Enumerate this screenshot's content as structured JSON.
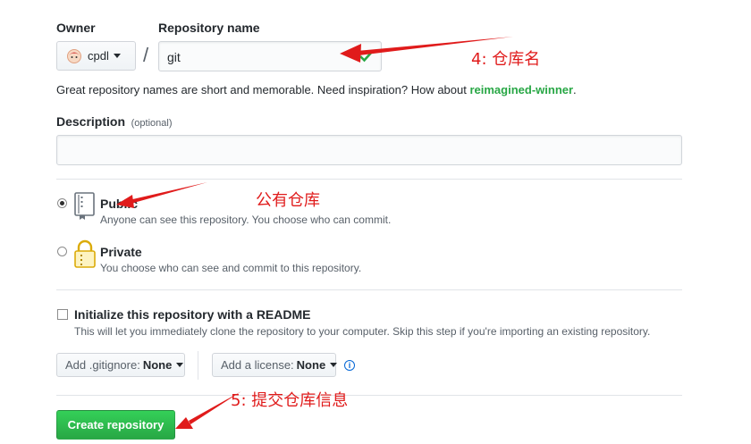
{
  "owner": {
    "label": "Owner",
    "value": "cpdl"
  },
  "repo": {
    "label": "Repository name",
    "value": "git"
  },
  "slash": "/",
  "hint": {
    "prefix": "Great repository names are short and memorable. Need inspiration? How about ",
    "suggestion": "reimagined-winner",
    "suffix": "."
  },
  "description": {
    "label": "Description",
    "optional": "(optional)",
    "value": ""
  },
  "visibility": {
    "public": {
      "title": "Public",
      "desc": "Anyone can see this repository. You choose who can commit.",
      "checked": true
    },
    "private": {
      "title": "Private",
      "desc": "You choose who can see and commit to this repository.",
      "checked": false
    }
  },
  "readme": {
    "label": "Initialize this repository with a README",
    "desc": "This will let you immediately clone the repository to your computer. Skip this step if you're importing an existing repository.",
    "checked": false
  },
  "gitignore": {
    "prefix": "Add .gitignore:",
    "value": "None"
  },
  "license": {
    "prefix": "Add a license:",
    "value": "None"
  },
  "info_icon": "i",
  "create_button": "Create repository",
  "annotations": {
    "a4": "4:  仓库名",
    "public": "公有仓库",
    "a5": "5:  提交仓库信息",
    "color": "#e01b1b"
  }
}
